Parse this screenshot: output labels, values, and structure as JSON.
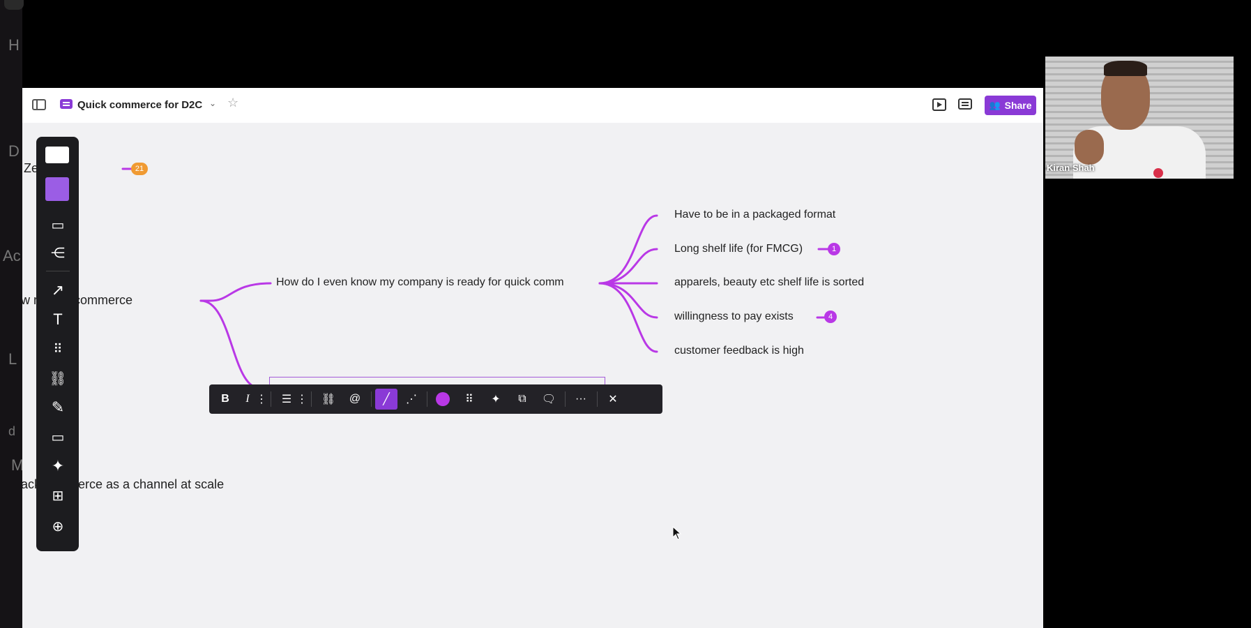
{
  "left_strip": {
    "ghost_letters": [
      "H",
      "D",
      "Ac",
      "L",
      "d",
      "M"
    ]
  },
  "header": {
    "board_title": "Quick commerce for D2C",
    "share_label": "Share"
  },
  "canvas": {
    "partial_texts": {
      "journey": "Ze    urney",
      "root": "w         r quick commerce",
      "bottom": "ack      commerce as a channel at scale"
    },
    "journey_badge": "21",
    "branch_node": "How do I even know my company is ready for quick comm",
    "leaves": [
      {
        "text": "Have to be in a packaged format",
        "badge": null
      },
      {
        "text": "Long shelf life (for FMCG)",
        "badge": "1"
      },
      {
        "text": "apparels, beauty etc shelf life is sorted",
        "badge": null
      },
      {
        "text": "willingness to pay exists",
        "badge": "4"
      },
      {
        "text": "customer feedback is high",
        "badge": null
      }
    ],
    "connector_color": "#b938e6"
  },
  "format_toolbar": {
    "bold": "B",
    "italic": "I",
    "mention": "@",
    "more": "···",
    "close": "✕"
  },
  "video": {
    "participant_name": "Kiran Shah"
  },
  "colors": {
    "accent": "#8a3ad6",
    "toolbar_bg": "#1c1c1f",
    "canvas_bg": "#f1f1f3"
  }
}
